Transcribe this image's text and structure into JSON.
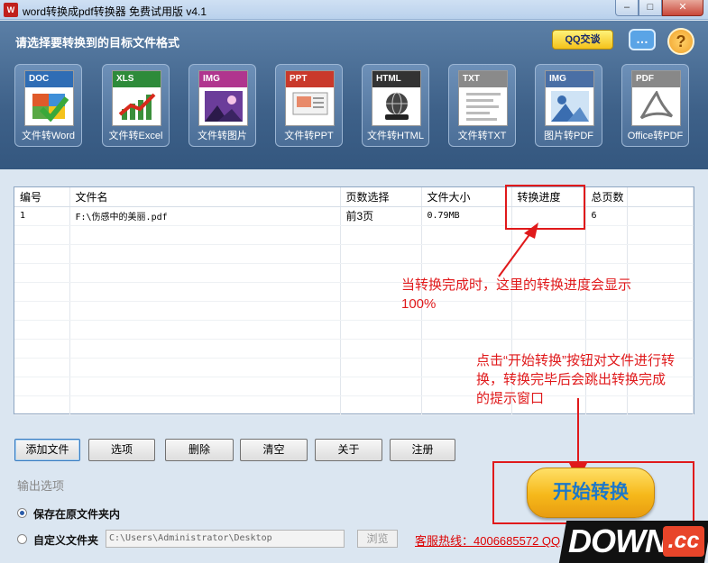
{
  "window": {
    "title": "word转换成pdf转换器 免费试用版 v4.1",
    "minimize": "–",
    "maximize": "□",
    "close": "✕"
  },
  "header": {
    "prompt": "请选择要转换到的目标文件格式",
    "qq_button": "QQ交谈",
    "chat_icon": "…",
    "help_icon": "?"
  },
  "tools": [
    {
      "band": "DOC",
      "label": "文件转Word",
      "color": "#2f6db5",
      "icon": "word-doc-icon"
    },
    {
      "band": "XLS",
      "label": "文件转Excel",
      "color": "#2e8b3a",
      "icon": "excel-chart-icon"
    },
    {
      "band": "IMG",
      "label": "文件转图片",
      "color": "#b0358e",
      "icon": "image-icon"
    },
    {
      "band": "PPT",
      "label": "文件转PPT",
      "color": "#c9392b",
      "icon": "ppt-icon"
    },
    {
      "band": "HTML",
      "label": "文件转HTML",
      "color": "#333333",
      "icon": "html-globe-icon"
    },
    {
      "band": "TXT",
      "label": "文件转TXT",
      "color": "#8a8a8a",
      "icon": "txt-icon"
    },
    {
      "band": "IMG",
      "label": "图片转PDF",
      "color": "#4a6fa5",
      "icon": "image-to-pdf-icon"
    },
    {
      "band": "PDF",
      "label": "Office转PDF",
      "color": "#888888",
      "icon": "pdf-icon"
    }
  ],
  "table": {
    "columns": [
      "编号",
      "文件名",
      "页数选择",
      "文件大小",
      "转换进度",
      "总页数",
      ""
    ],
    "rows": [
      {
        "no": "1",
        "name": "F:\\伤感中的美丽.pdf",
        "pages": "前3页",
        "size": "0.79MB",
        "progress": "",
        "total": "6"
      }
    ]
  },
  "annotations": {
    "progress_note_line1": "当转换完成时，这里的转换进度会显示",
    "progress_note_line2": "100%",
    "start_note_line1": "点击“开始转换”按钮对文件进行转",
    "start_note_line2": "换，转换完毕后会跳出转换完成",
    "start_note_line3": "的提示窗口"
  },
  "buttons": {
    "add": "添加文件",
    "options": "选项",
    "delete": "删除",
    "clear": "清空",
    "about": "关于",
    "register": "注册"
  },
  "output": {
    "section_label": "输出选项",
    "option_same_folder": "保存在原文件夹内",
    "option_custom": "自定义文件夹",
    "path": "C:\\Users\\Administrator\\Desktop",
    "browse": "浏览",
    "selected": "same_folder"
  },
  "hotline": "客服热线：4006685572 QQ",
  "start_button": "开始转换",
  "watermark": {
    "main": "DOWN",
    "suffix": ".cc"
  }
}
